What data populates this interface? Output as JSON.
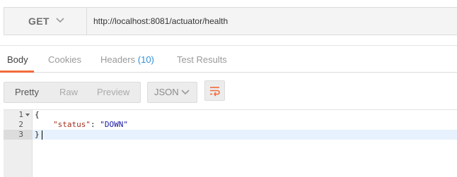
{
  "request": {
    "method": "GET",
    "url": "http://localhost:8081/actuator/health"
  },
  "response_tabs": [
    {
      "label": "Body",
      "active": true
    },
    {
      "label": "Cookies",
      "active": false
    },
    {
      "label": "Headers",
      "count": "(10)",
      "active": false
    },
    {
      "label": "Test Results",
      "active": false
    }
  ],
  "view_modes": [
    {
      "label": "Pretty",
      "active": true
    },
    {
      "label": "Raw",
      "active": false
    },
    {
      "label": "Preview",
      "active": false
    }
  ],
  "format": {
    "selected": "JSON"
  },
  "editor": {
    "line_numbers": [
      "1",
      "2",
      "3"
    ],
    "lines": {
      "open": "{",
      "key": "\"status\"",
      "separator": ": ",
      "value": "\"DOWN\"",
      "close": "}"
    }
  },
  "colors": {
    "accent": "#f26b3a",
    "link_blue": "#2f8fd8",
    "json_key": "#a0301d",
    "json_string": "#1a1aa6"
  },
  "icons": [
    "chevron-down-icon",
    "wrap-lines-icon",
    "fold-arrow-icon"
  ]
}
